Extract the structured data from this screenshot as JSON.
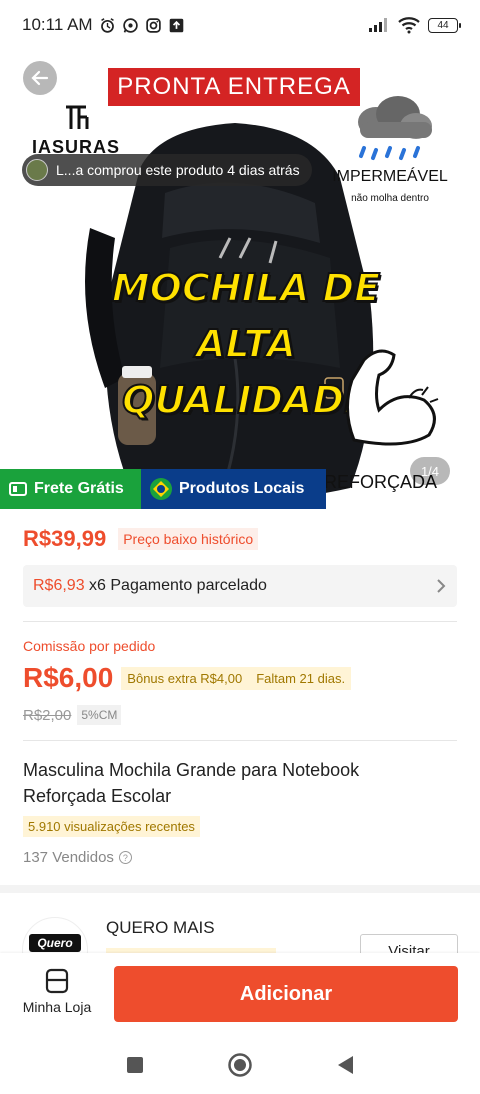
{
  "status_bar": {
    "time": "10:11 AM",
    "battery": "44"
  },
  "hero": {
    "banner": "PRONTA ENTREGA",
    "brand": "IASURAS",
    "purchase_notice": "L...a comprou este produto 4 dias atrás",
    "waterproof": "IMPERMEÁVEL",
    "waterproof_sub": "não molha dentro",
    "headline": [
      "MOCHILA DE",
      "ALTA",
      "QUALIDADE"
    ],
    "reinforced": "REFORÇADA",
    "page_indicator": "1/4"
  },
  "badges": {
    "free_shipping": "Frete Grátis",
    "local_products": "Produtos Locais"
  },
  "price": {
    "current": "R$39,99",
    "low_tag": "Preço baixo histórico",
    "installment_amount": "R$6,93",
    "installment_text": " x6 Pagamento parcelado"
  },
  "commission": {
    "label": "Comissão por pedido",
    "value": "R$6,00",
    "bonus": "Bônus extra R$4,00",
    "days_left": "Faltam 21 dias.",
    "old_value": "R$2,00",
    "cm_tag": "5%CM"
  },
  "product": {
    "title": "Masculina Mochila Grande para Notebook Reforçada Escolar",
    "views": "5.910 visualizações recentes",
    "sold": "137 Vendidos"
  },
  "store": {
    "name": "QUERO MAIS",
    "avatar_text": "Quero",
    "visit": "Visitar"
  },
  "bottom": {
    "my_store": "Minha Loja",
    "add": "Adicionar"
  },
  "colors": {
    "accent": "#ee4d2d",
    "green": "#1aa23c",
    "blue": "#0a3d8a",
    "headline": "#ffe100"
  }
}
